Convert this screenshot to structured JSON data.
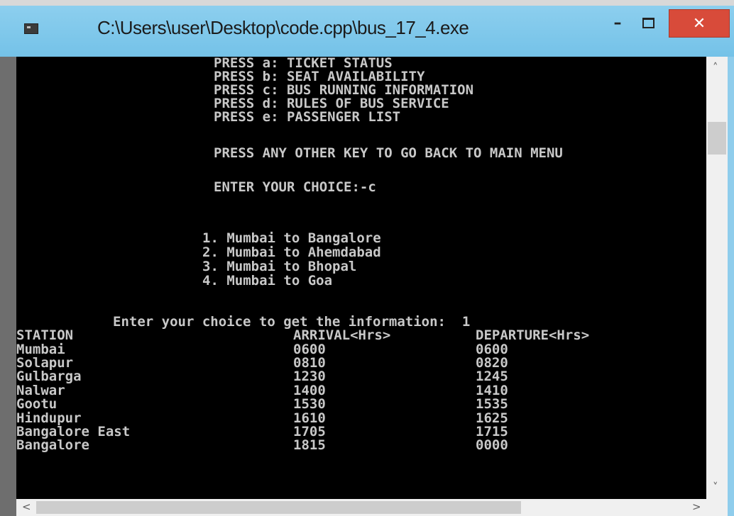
{
  "window": {
    "title": "C:\\Users\\user\\Desktop\\code.cpp\\bus_17_4.exe",
    "minimize_glyph": "–",
    "close_glyph": "✕",
    "titlebar_color": "#7fc8ec",
    "close_color": "#d84b3a"
  },
  "menu_lines": [
    "PRESS a: TICKET STATUS",
    "PRESS b: SEAT AVAILABILITY",
    "PRESS c: BUS RUNNING INFORMATION",
    "PRESS d: RULES OF BUS SERVICE",
    "PRESS e: PASSENGER LIST",
    "PRESS ANY OTHER KEY TO GO BACK TO MAIN MENU",
    "ENTER YOUR CHOICE:-c"
  ],
  "routes": [
    "1. Mumbai to Bangalore",
    "2. Mumbai to Ahemdabad",
    "3. Mumbai to Bhopal",
    "4. Mumbai to Goa"
  ],
  "prompt": "Enter your choice to get the information:  1",
  "table": {
    "headers": [
      "STATION",
      "ARRIVAL<Hrs>",
      "DEPARTURE<Hrs>"
    ],
    "rows": [
      [
        "Mumbai",
        "0600",
        "0600"
      ],
      [
        "Solapur",
        "0810",
        "0820"
      ],
      [
        "Gulbarga",
        "1230",
        "1245"
      ],
      [
        "Nalwar",
        "1400",
        "1410"
      ],
      [
        "Gootu",
        "1530",
        "1535"
      ],
      [
        "Hindupur",
        "1610",
        "1625"
      ],
      [
        "Bangalore East",
        "1705",
        "1715"
      ],
      [
        "Bangalore",
        "1815",
        "0000"
      ]
    ]
  },
  "scroll": {
    "up_glyph": "˄",
    "down_glyph": "˅",
    "left_glyph": "<",
    "right_glyph": ">"
  }
}
